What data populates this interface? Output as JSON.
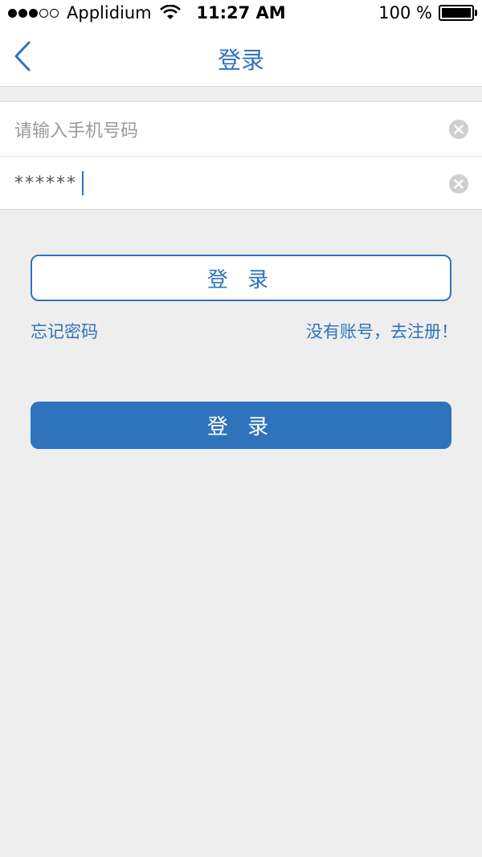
{
  "status_bar": {
    "carrier": "Applidium",
    "time": "11:27 AM",
    "battery": "100 %"
  },
  "nav": {
    "title": "登录",
    "back_icon": "chevron-left-icon"
  },
  "form": {
    "phone": {
      "placeholder": "请输入手机号码",
      "value": ""
    },
    "password": {
      "value": "******"
    }
  },
  "buttons": {
    "outline_login": "登 录",
    "solid_login": "登 录"
  },
  "links": {
    "forgot_password": "忘记密码",
    "register": "没有账号，去注册！"
  },
  "colors": {
    "accent": "#2f73bd",
    "background": "#eeeeee"
  }
}
